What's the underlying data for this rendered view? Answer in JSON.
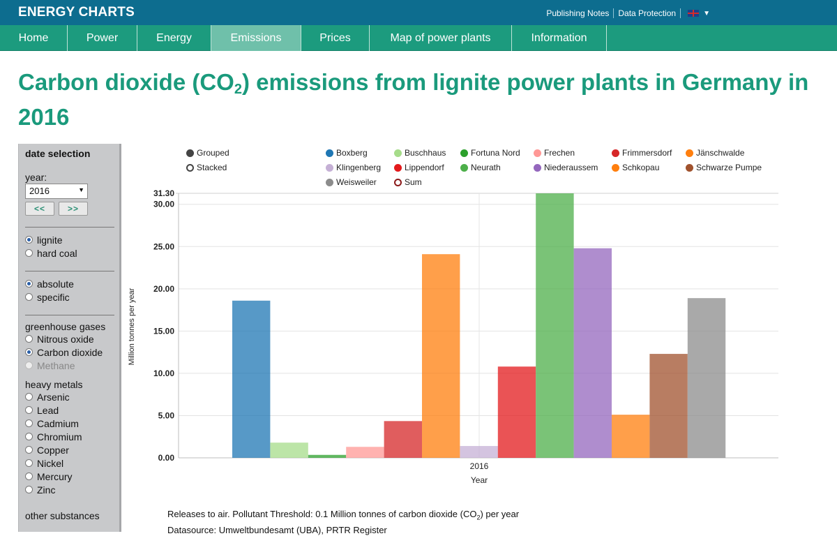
{
  "brand": "ENERGY CHARTS",
  "top_links": {
    "publishing_notes": "Publishing Notes",
    "data_protection": "Data Protection",
    "language_dropdown": "▼"
  },
  "nav": {
    "tabs": [
      "Home",
      "Power",
      "Energy",
      "Emissions",
      "Prices",
      "Map of power plants",
      "Information"
    ],
    "active": "Emissions"
  },
  "page_title": {
    "before_sub": "Carbon dioxide (CO",
    "sub": "2",
    "after_sub": ") emissions from lignite power plants in Germany in 2016"
  },
  "sidebar": {
    "heading": "date selection",
    "year_label": "year:",
    "year_value": "2016",
    "prev_button": "<<",
    "next_button": ">>",
    "fuel": [
      {
        "label": "lignite",
        "selected": true
      },
      {
        "label": "hard coal",
        "selected": false
      }
    ],
    "mode": [
      {
        "label": "absolute",
        "selected": true
      },
      {
        "label": "specific",
        "selected": false
      }
    ],
    "greenhouse_title": "greenhouse gases",
    "greenhouse": [
      {
        "label": "Nitrous oxide",
        "selected": false
      },
      {
        "label": "Carbon dioxide",
        "selected": true
      },
      {
        "label": "Methane",
        "selected": false,
        "disabled": true
      }
    ],
    "metals_title": "heavy metals",
    "metals": [
      "Arsenic",
      "Lead",
      "Cadmium",
      "Chromium",
      "Copper",
      "Nickel",
      "Mercury",
      "Zinc"
    ],
    "other_title": "other substances"
  },
  "chart_options": [
    {
      "label": "Grouped",
      "selected": true
    },
    {
      "label": "Stacked",
      "selected": false
    }
  ],
  "sum_label": "Sum",
  "chart_data": {
    "type": "bar",
    "categories": [
      "2016"
    ],
    "xlabel": "Year",
    "ylabel": "Million tonnes per year",
    "ylim": [
      0,
      31.3
    ],
    "yticks": [
      "0.00",
      "5.00",
      "10.00",
      "15.00",
      "20.00",
      "25.00",
      "30.00"
    ],
    "ymax_label": "31.30",
    "grid": true,
    "legend_position": "top",
    "series": [
      {
        "name": "Boxberg",
        "color": "#1f77b4",
        "values": [
          18.6
        ]
      },
      {
        "name": "Buschhaus",
        "color": "#a6dc8a",
        "values": [
          1.8
        ]
      },
      {
        "name": "Fortuna Nord",
        "color": "#2ca02c",
        "values": [
          0.35
        ]
      },
      {
        "name": "Frechen",
        "color": "#ff9896",
        "values": [
          1.3
        ]
      },
      {
        "name": "Frimmersdorf",
        "color": "#d62728",
        "values": [
          4.35
        ]
      },
      {
        "name": "Jänschwalde",
        "color": "#ff7f0e",
        "values": [
          24.1
        ]
      },
      {
        "name": "Klingenberg",
        "color": "#c5b0d5",
        "values": [
          1.4
        ]
      },
      {
        "name": "Lippendorf",
        "color": "#e31a1c",
        "values": [
          10.8
        ]
      },
      {
        "name": "Neurath",
        "color": "#4daf4a",
        "values": [
          31.3
        ]
      },
      {
        "name": "Niederaussem",
        "color": "#9467bd",
        "values": [
          24.8
        ]
      },
      {
        "name": "Schkopau",
        "color": "#ff7f0e",
        "values": [
          5.1
        ]
      },
      {
        "name": "Schwarze Pumpe",
        "color": "#a0522d",
        "values": [
          12.3
        ]
      },
      {
        "name": "Weisweiler",
        "color": "#8c8c8c",
        "values": [
          18.9
        ]
      }
    ]
  },
  "caption": {
    "line1_before": "Releases to air. Pollutant Threshold: 0.1 Million tonnes of carbon dioxide (CO",
    "line1_sub": "2",
    "line1_after": ") per year",
    "line2": "Datasource: Umweltbundesamt (UBA), PRTR Register"
  }
}
